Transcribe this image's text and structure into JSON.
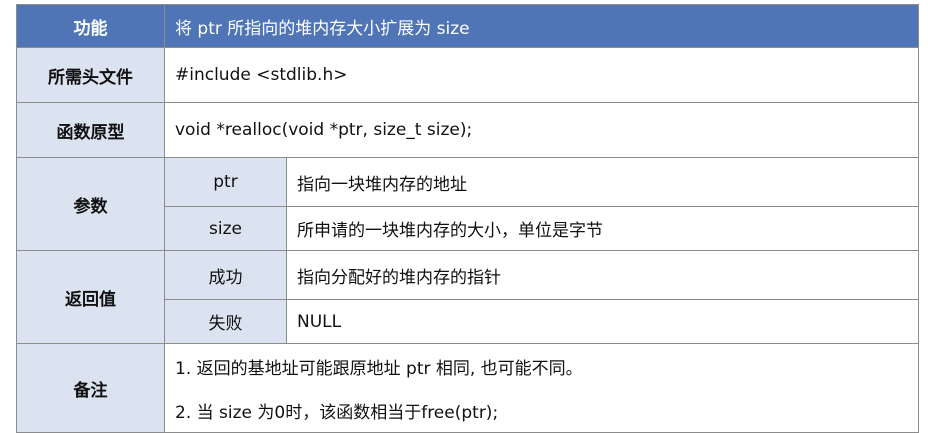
{
  "header": {
    "key": "功能",
    "value": "将 ptr 所指向的堆内存大小扩展为 size"
  },
  "rows": {
    "header_file": {
      "key": "所需头文件",
      "value": "#include <stdlib.h>"
    },
    "prototype": {
      "key": "函数原型",
      "value": "void *realloc(void *ptr, size_t size);"
    },
    "params": {
      "key": "参数",
      "items": [
        {
          "name": "ptr",
          "desc": "指向一块堆内存的地址"
        },
        {
          "name": "size",
          "desc": "所申请的一块堆内存的大小，单位是字节"
        }
      ]
    },
    "return": {
      "key": "返回值",
      "items": [
        {
          "name": "成功",
          "desc": "指向分配好的堆内存的指针"
        },
        {
          "name": "失败",
          "desc": "NULL"
        }
      ]
    },
    "notes": {
      "key": "备注",
      "lines": [
        "1. 返回的基地址可能跟原地址 ptr 相同, 也可能不同。",
        "2. 当 size 为0时，该函数相当于free(ptr);"
      ]
    }
  },
  "colors": {
    "header_bg": "#4f75b6",
    "key_bg": "#dbe3f1",
    "border": "#8c8c8c"
  }
}
